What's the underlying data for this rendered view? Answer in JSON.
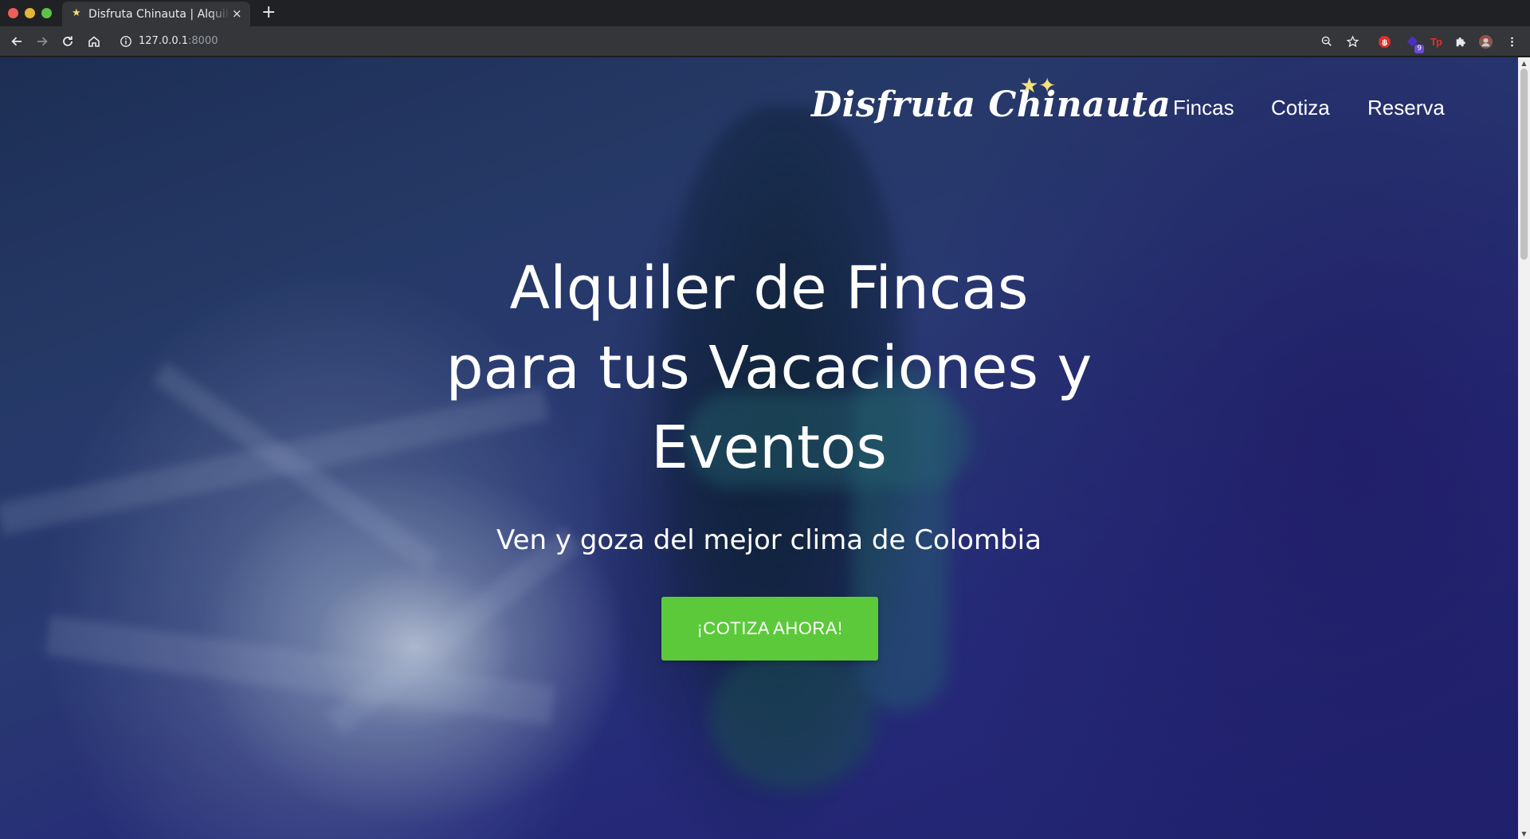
{
  "browser": {
    "tab": {
      "title": "Disfruta Chinauta | Alquiler de Fincas",
      "favicon": "star-icon",
      "close": "×"
    },
    "new_tab": "+",
    "toolbar": {
      "back": "back-arrow-icon",
      "forward": "forward-arrow-icon",
      "reload": "reload-icon",
      "home": "home-icon"
    },
    "address": {
      "host": "127.0.0.1",
      "port": ":8000"
    },
    "extension_badge": "9"
  },
  "site": {
    "brand": "Disfruta Chinauta",
    "brand_stars": "★✦",
    "nav": [
      {
        "label": "Fincas"
      },
      {
        "label": "Cotiza"
      },
      {
        "label": "Reserva"
      }
    ]
  },
  "hero": {
    "title_lines": [
      "Alquiler de Fincas",
      "para tus Vacaciones y",
      "Eventos"
    ],
    "subtitle": "Ven y goza del mejor clima de Colombia",
    "cta_label": "¡COTIZA AHORA!"
  },
  "colors": {
    "cta": "#5cc93b",
    "tab_bg": "#35363a",
    "chrome_bg": "#202124"
  }
}
